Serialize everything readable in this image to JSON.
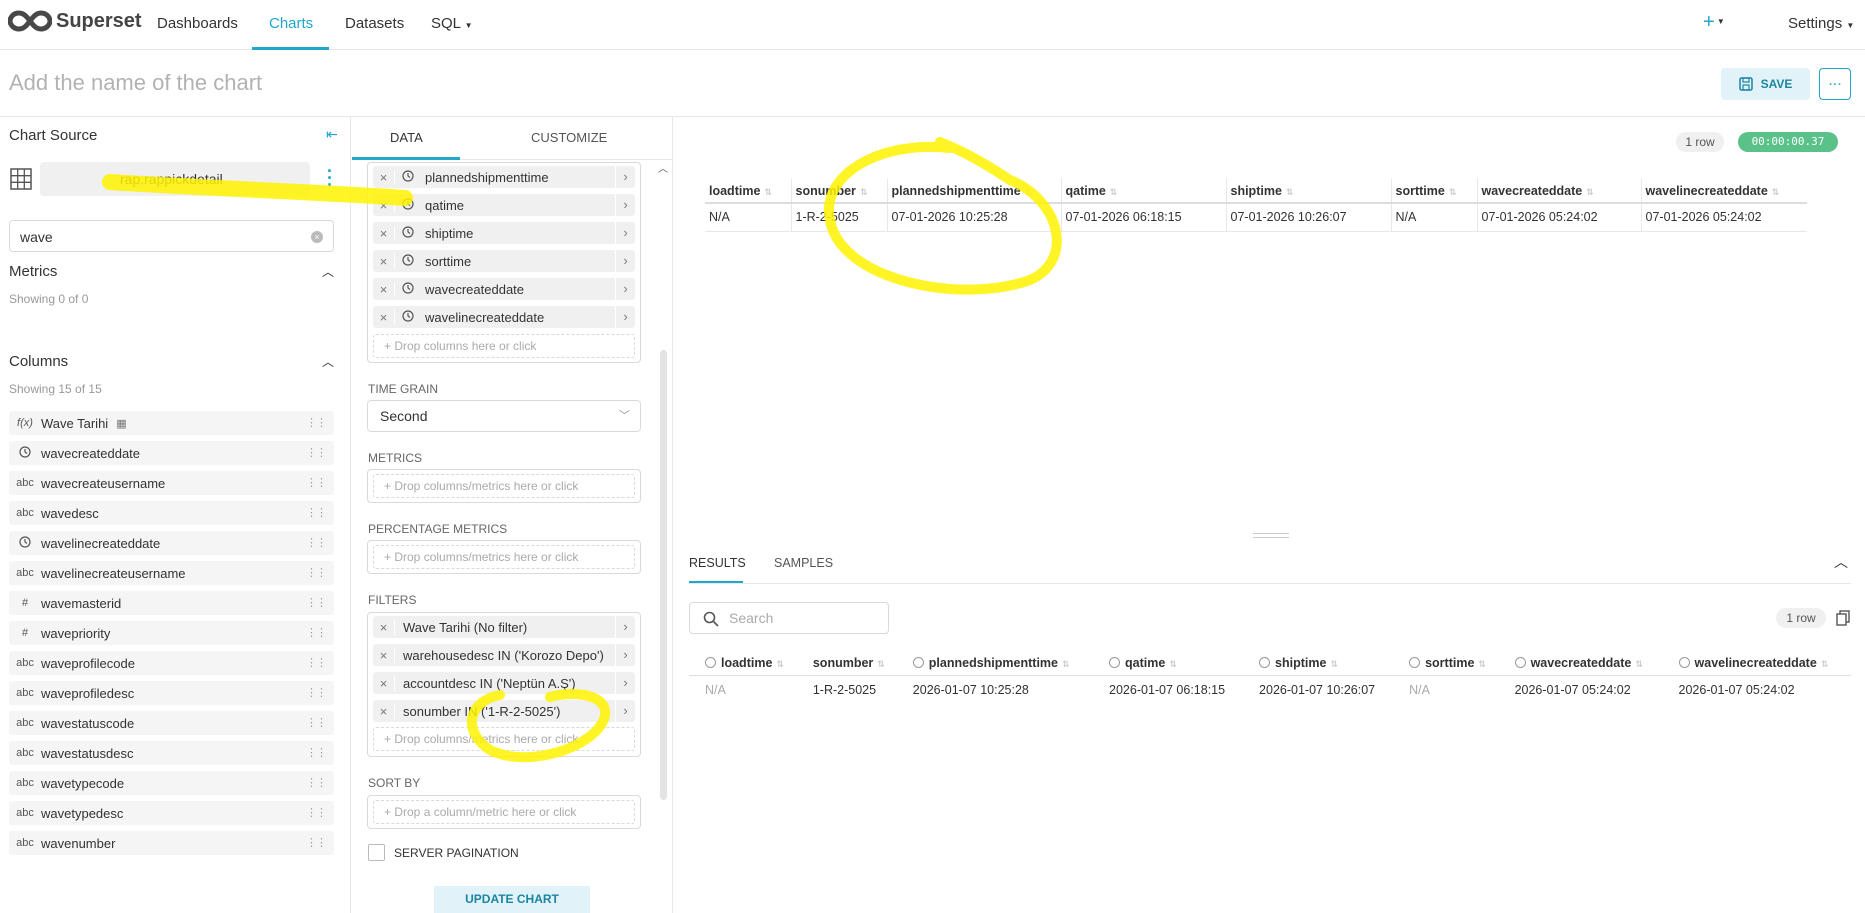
{
  "nav": {
    "brand": "Superset",
    "items": [
      "Dashboards",
      "Charts",
      "Datasets",
      "SQL"
    ],
    "plus": "+",
    "settings": "Settings"
  },
  "header": {
    "chart_name_placeholder": "Add the name of the chart",
    "save_label": "SAVE",
    "more_label": "..."
  },
  "left": {
    "title": "Chart Source",
    "dataset": "rap.rappickdetail",
    "search_value": "wave",
    "metrics_title": "Metrics",
    "metrics_count": "Showing 0 of 0",
    "columns_title": "Columns",
    "columns_count": "Showing 15 of 15",
    "columns": [
      {
        "type": "f(x)",
        "name": "Wave Tarihi"
      },
      {
        "type": "clock",
        "name": "wavecreateddate"
      },
      {
        "type": "abc",
        "name": "wavecreateusername"
      },
      {
        "type": "abc",
        "name": "wavedesc"
      },
      {
        "type": "clock",
        "name": "wavelinecreateddate"
      },
      {
        "type": "abc",
        "name": "wavelinecreateusername"
      },
      {
        "type": "#",
        "name": "wavemasterid"
      },
      {
        "type": "#",
        "name": "wavepriority"
      },
      {
        "type": "abc",
        "name": "waveprofilecode"
      },
      {
        "type": "abc",
        "name": "waveprofiledesc"
      },
      {
        "type": "abc",
        "name": "wavestatuscode"
      },
      {
        "type": "abc",
        "name": "wavestatusdesc"
      },
      {
        "type": "abc",
        "name": "wavetypecode"
      },
      {
        "type": "abc",
        "name": "wavetypedesc"
      },
      {
        "type": "abc",
        "name": "wavenumber"
      }
    ]
  },
  "mid": {
    "tab_data": "DATA",
    "tab_customize": "CUSTOMIZE",
    "selected_columns": [
      "plannedshipmenttime",
      "qatime",
      "shiptime",
      "sorttime",
      "wavecreateddate",
      "wavelinecreateddate"
    ],
    "drop_columns": "Drop columns here or click",
    "time_grain_label": "TIME GRAIN",
    "time_grain_value": "Second",
    "metrics_label": "METRICS",
    "drop_metrics": "Drop columns/metrics here or click",
    "pct_metrics_label": "PERCENTAGE METRICS",
    "filters_label": "FILTERS",
    "filters": [
      "Wave Tarihi (No filter)",
      "warehousedesc IN ('Korozo Depo')",
      "accountdesc IN ('Neptün A.Ş')",
      "sonumber IN ('1-R-2-5025')"
    ],
    "sort_by_label": "SORT BY",
    "drop_sort": "Drop a column/metric here or click",
    "server_pagination": "SERVER PAGINATION",
    "update_chart": "UPDATE CHART"
  },
  "result_top": {
    "row_count": "1 row",
    "duration": "00:00:00.37",
    "headers": [
      "loadtime",
      "sonumber",
      "plannedshipmenttime",
      "qatime",
      "shiptime",
      "sorttime",
      "wavecreateddate",
      "wavelinecreateddate"
    ],
    "row": [
      "N/A",
      "1-R-2-5025",
      "07-01-2026 10:25:28",
      "07-01-2026 06:18:15",
      "07-01-2026 10:26:07",
      "N/A",
      "07-01-2026 05:24:02",
      "07-01-2026 05:24:02"
    ]
  },
  "result_bottom": {
    "tab_results": "RESULTS",
    "tab_samples": "SAMPLES",
    "search_placeholder": "Search",
    "row_count": "1 row",
    "headers": [
      "loadtime",
      "sonumber",
      "plannedshipmenttime",
      "qatime",
      "shiptime",
      "sorttime",
      "wavecreateddate",
      "wavelinecreateddate"
    ],
    "row": [
      "N/A",
      "1-R-2-5025",
      "2026-01-07 10:25:28",
      "2026-01-07 06:18:15",
      "2026-01-07 10:26:07",
      "N/A",
      "2026-01-07 05:24:02",
      "2026-01-07 05:24:02"
    ]
  },
  "colors": {
    "accent": "#20a7c9",
    "success": "#5ac189",
    "highlighter": "#fff200"
  }
}
